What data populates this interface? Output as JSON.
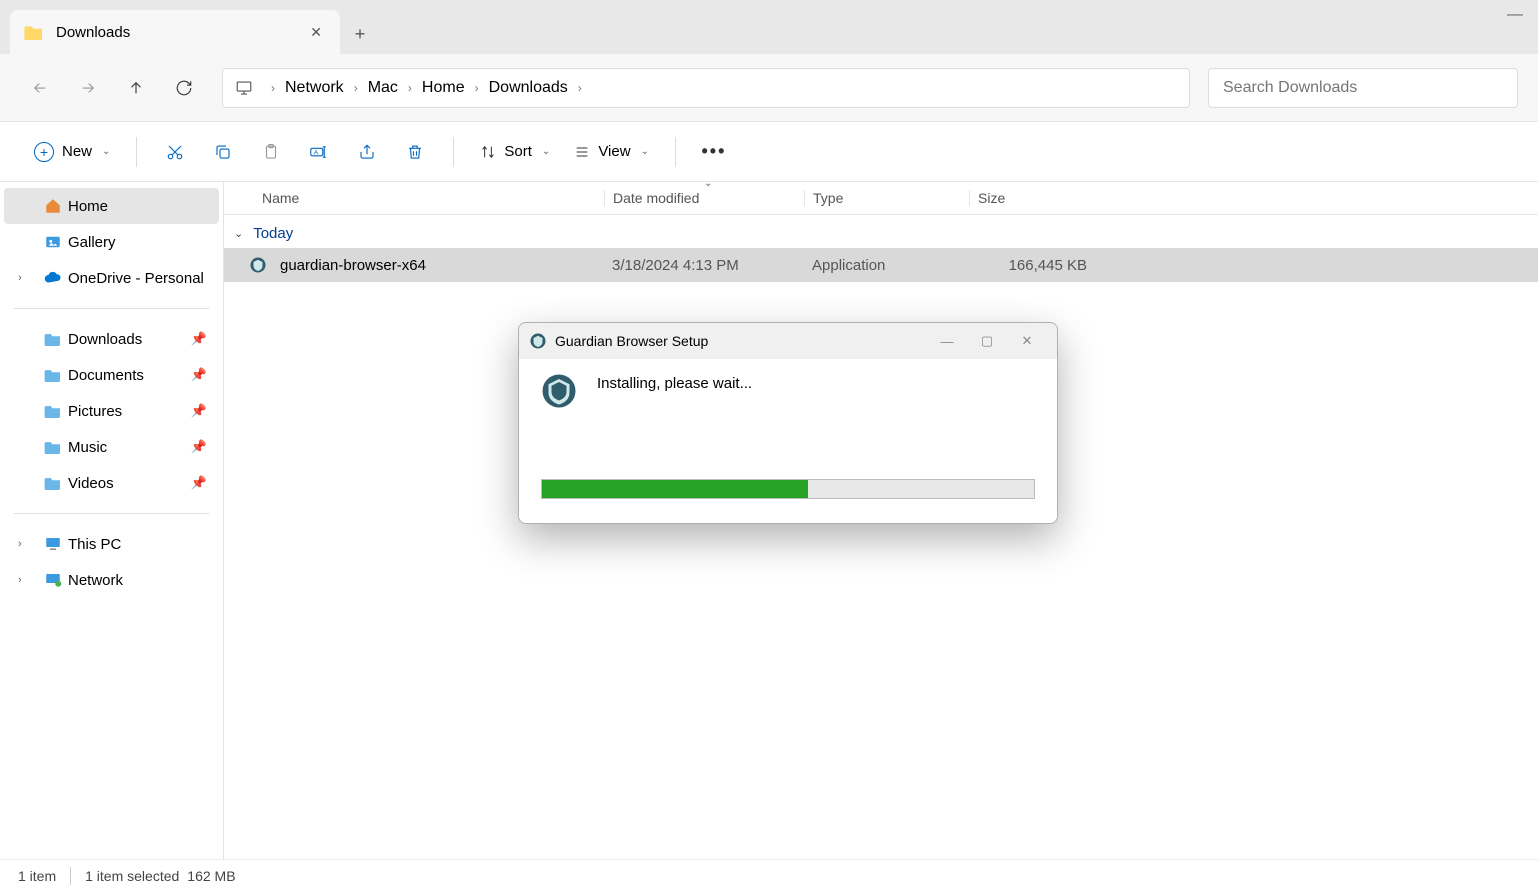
{
  "tab": {
    "title": "Downloads"
  },
  "breadcrumb": [
    "Network",
    "Mac",
    "Home",
    "Downloads"
  ],
  "search": {
    "placeholder": "Search Downloads"
  },
  "toolbar": {
    "new_label": "New",
    "sort_label": "Sort",
    "view_label": "View"
  },
  "sidebar": {
    "home": "Home",
    "gallery": "Gallery",
    "onedrive": "OneDrive - Personal",
    "downloads": "Downloads",
    "documents": "Documents",
    "pictures": "Pictures",
    "music": "Music",
    "videos": "Videos",
    "thispc": "This PC",
    "network": "Network"
  },
  "columns": {
    "name": "Name",
    "date": "Date modified",
    "type": "Type",
    "size": "Size"
  },
  "group": {
    "today": "Today"
  },
  "files": [
    {
      "name": "guardian-browser-x64",
      "date": "3/18/2024 4:13 PM",
      "type": "Application",
      "size": "166,445 KB"
    }
  ],
  "status": {
    "count": "1 item",
    "selected": "1 item selected",
    "size": "162 MB"
  },
  "dialog": {
    "title": "Guardian Browser Setup",
    "message": "Installing, please wait...",
    "progress": 54
  }
}
